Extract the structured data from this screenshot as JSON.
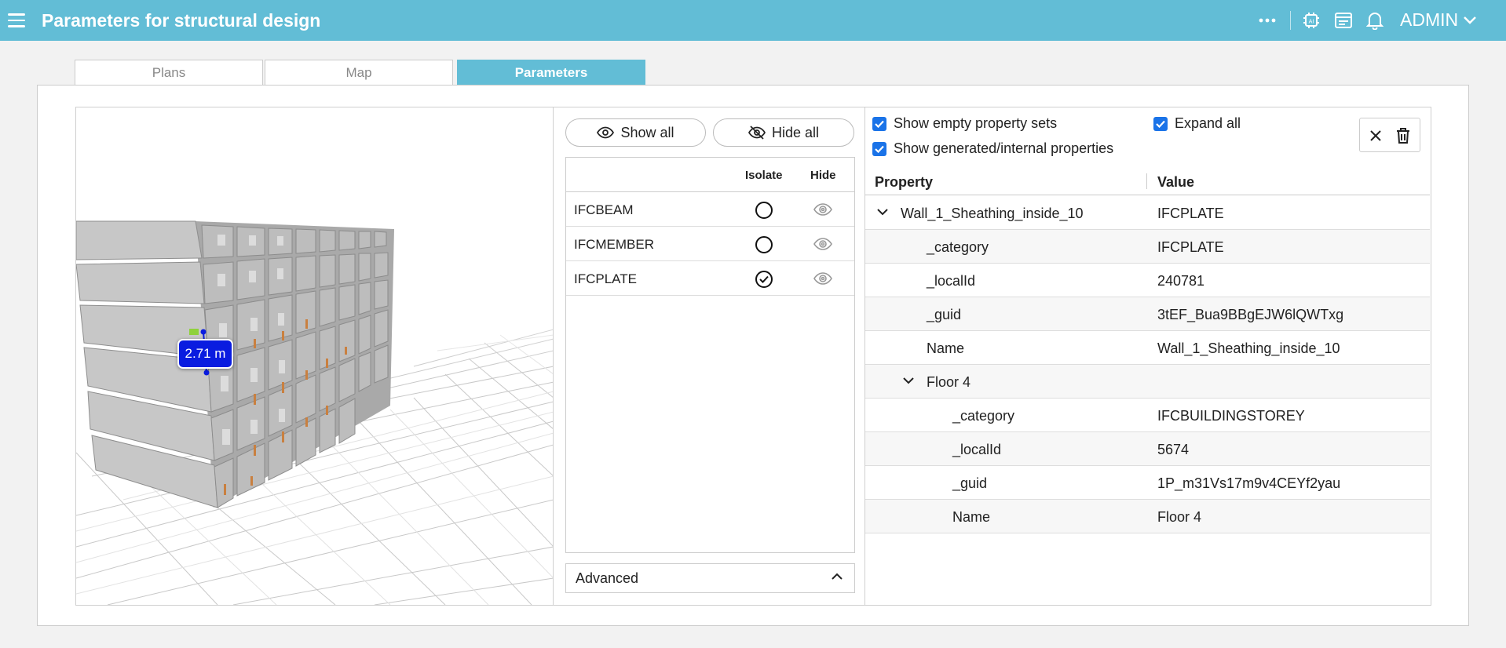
{
  "header": {
    "title": "Parameters for structural design",
    "user": "ADMIN",
    "icons": [
      "more-icon",
      "ai-chip-icon",
      "news-icon",
      "bell-icon"
    ]
  },
  "tabs": [
    {
      "label": "Plans"
    },
    {
      "label": "Map"
    },
    {
      "label": "Parameters",
      "active": true
    }
  ],
  "viewer": {
    "measurement": "2.71 m"
  },
  "filter": {
    "show_all": "Show all",
    "hide_all": "Hide all",
    "col_isolate": "Isolate",
    "col_hide": "Hide",
    "rows": [
      {
        "name": "IFCBEAM",
        "isolated": false
      },
      {
        "name": "IFCMEMBER",
        "isolated": false
      },
      {
        "name": "IFCPLATE",
        "isolated": true
      }
    ],
    "advanced": "Advanced"
  },
  "options": {
    "show_empty": "Show empty property sets",
    "expand_all": "Expand all",
    "show_generated": "Show generated/internal properties"
  },
  "properties": {
    "col_property": "Property",
    "col_value": "Value",
    "rows": [
      {
        "k": "Wall_1_Sheathing_inside_10",
        "v": "IFCPLATE"
      },
      {
        "k": "_category",
        "v": "IFCPLATE"
      },
      {
        "k": "_localId",
        "v": "240781"
      },
      {
        "k": "_guid",
        "v": "3tEF_Bua9BBgEJW6lQWTxg"
      },
      {
        "k": "Name",
        "v": "Wall_1_Sheathing_inside_10"
      },
      {
        "k": "Floor 4",
        "v": ""
      },
      {
        "k": "_category",
        "v": "IFCBUILDINGSTOREY"
      },
      {
        "k": "_localId",
        "v": "5674"
      },
      {
        "k": "_guid",
        "v": "1P_m31Vs17m9v4CEYf2yau"
      },
      {
        "k": "Name",
        "v": "Floor 4"
      }
    ]
  },
  "colors": {
    "header": "#62bdd6",
    "measure": "#0a1ce0",
    "checkbox": "#1a73e8"
  }
}
